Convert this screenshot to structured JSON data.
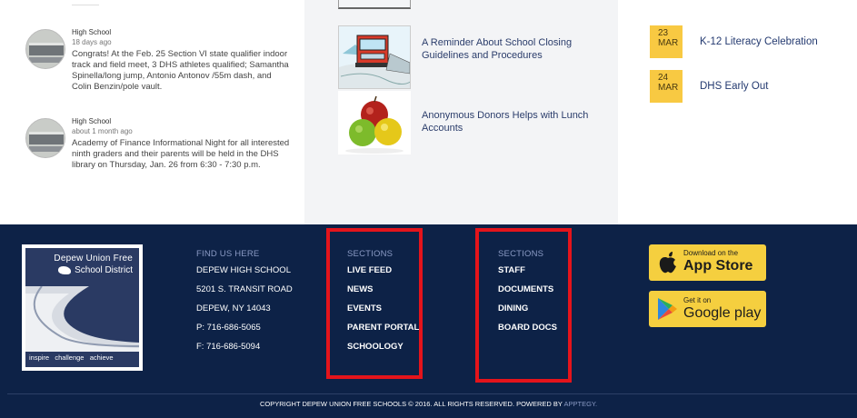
{
  "feed": {
    "items": [
      {
        "source": "High School",
        "time": "18 days ago",
        "body": "Congrats! At the Feb. 25 Section VI state qualifier indoor track and field meet, 3 DHS athletes qualified; Samantha Spinella/long jump, Antonio Antonov /55m dash, and Colin Benzin/pole vault."
      },
      {
        "source": "High School",
        "time": "about 1 month ago",
        "body": "Academy of Finance Informational Night for all interested ninth graders and their parents will be held in the DHS library on Thursday, Jan. 26 from 6:30 - 7:30 p.m."
      }
    ]
  },
  "news": {
    "items": [
      {
        "title": "A Reminder About School Closing Guidelines and Procedures"
      },
      {
        "title": "Anonymous Donors Helps with Lunch Accounts"
      }
    ]
  },
  "events": {
    "items": [
      {
        "day": "23",
        "month": "MAR",
        "title": "K-12 Literacy Celebration"
      },
      {
        "day": "24",
        "month": "MAR",
        "title": "DHS Early Out"
      }
    ]
  },
  "footer": {
    "logo": {
      "line1": "Depew Union Free",
      "line2": "School District",
      "tagline": "inspire   challenge   achieve"
    },
    "find_us": {
      "heading": "FIND US HERE",
      "lines": [
        "DEPEW HIGH SCHOOL",
        "5201 S. TRANSIT ROAD",
        "DEPEW, NY 14043",
        "P: 716-686-5065",
        "F: 716-686-5094"
      ]
    },
    "sections1": {
      "heading": "SECTIONS",
      "links": [
        "LIVE FEED",
        "NEWS",
        "EVENTS",
        "PARENT PORTAL",
        "SCHOOLOGY"
      ]
    },
    "sections2": {
      "heading": "SECTIONS",
      "links": [
        "STAFF",
        "DOCUMENTS",
        "DINING",
        "BOARD DOCS"
      ]
    },
    "app_store": {
      "small": "Download on the",
      "big": "App Store"
    },
    "google_play": {
      "small": "Get it on",
      "big": "Google play"
    },
    "copyright": "COPYRIGHT DEPEW UNION FREE SCHOOLS © 2016. ALL RIGHTS RESERVED. POWERED BY",
    "powered_by": "APPTEGY."
  },
  "colors": {
    "footer_bg": "#0d2247",
    "highlight": "#e4141b",
    "event_badge": "#f8c942",
    "link": "#2b3d6b"
  }
}
